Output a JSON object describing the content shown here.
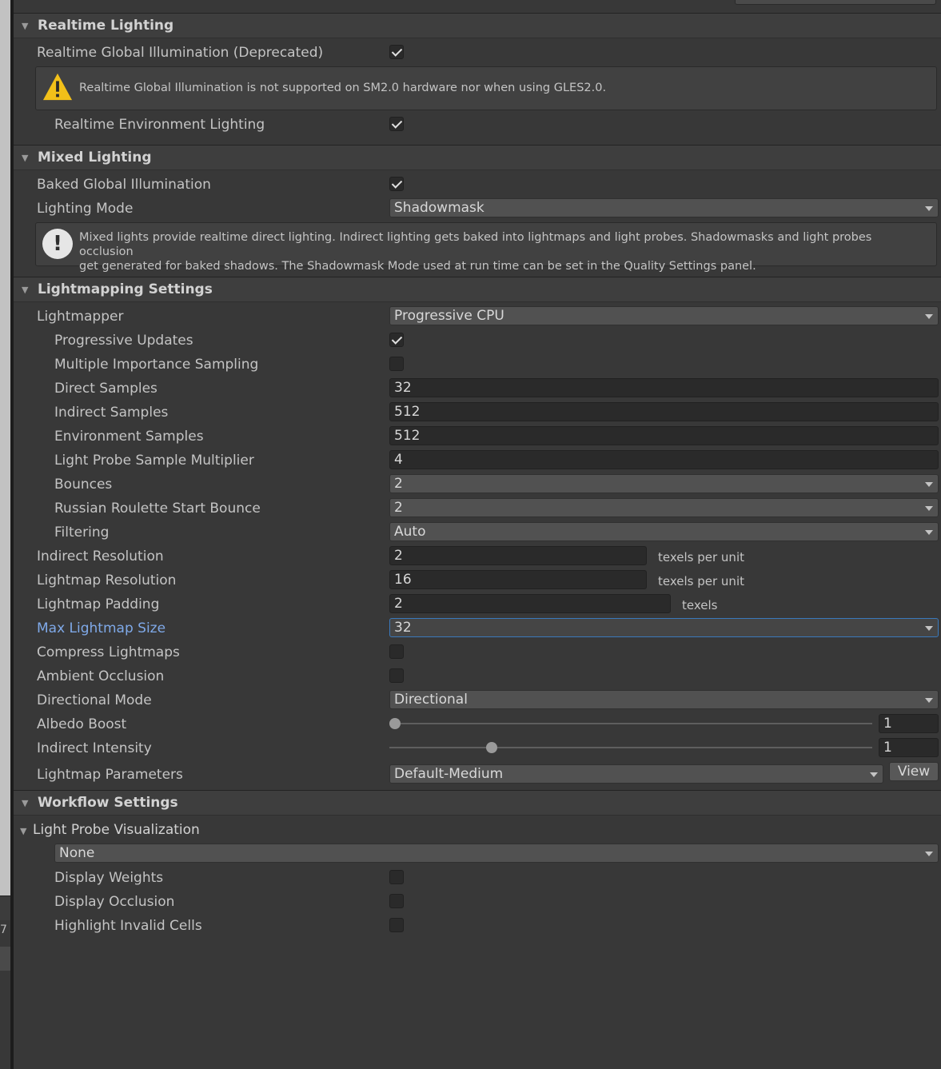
{
  "sections": {
    "realtime_lighting": "Realtime Lighting",
    "mixed_lighting": "Mixed Lighting",
    "lightmapping_settings": "Lightmapping Settings",
    "workflow_settings": "Workflow Settings"
  },
  "realtime": {
    "gi_label": "Realtime Global Illumination (Deprecated)",
    "gi_checked": true,
    "warning": "Realtime Global Illumination is not supported on SM2.0 hardware nor when using GLES2.0.",
    "env_label": "Realtime Environment Lighting",
    "env_checked": true
  },
  "mixed": {
    "baked_gi_label": "Baked Global Illumination",
    "baked_gi_checked": true,
    "mode_label": "Lighting Mode",
    "mode_value": "Shadowmask",
    "info_line1": "Mixed lights provide realtime direct lighting. Indirect lighting gets baked into lightmaps and light probes. Shadowmasks and light probes occlusion",
    "info_line2": "get generated for baked shadows. The Shadowmask Mode used at run time can be set in the Quality Settings panel."
  },
  "lightmapping": {
    "lightmapper_label": "Lightmapper",
    "lightmapper_value": "Progressive CPU",
    "progressive_updates_label": "Progressive Updates",
    "progressive_updates_checked": true,
    "mis_label": "Multiple Importance Sampling",
    "mis_checked": false,
    "direct_samples_label": "Direct Samples",
    "direct_samples_value": "32",
    "indirect_samples_label": "Indirect Samples",
    "indirect_samples_value": "512",
    "env_samples_label": "Environment Samples",
    "env_samples_value": "512",
    "probe_mult_label": "Light Probe Sample Multiplier",
    "probe_mult_value": "4",
    "bounces_label": "Bounces",
    "bounces_value": "2",
    "rr_label": "Russian Roulette Start Bounce",
    "rr_value": "2",
    "filtering_label": "Filtering",
    "filtering_value": "Auto",
    "indirect_res_label": "Indirect Resolution",
    "indirect_res_value": "2",
    "indirect_res_unit": "texels per unit",
    "lightmap_res_label": "Lightmap Resolution",
    "lightmap_res_value": "16",
    "lightmap_res_unit": "texels per unit",
    "padding_label": "Lightmap Padding",
    "padding_value": "2",
    "padding_unit": "texels",
    "max_size_label": "Max Lightmap Size",
    "max_size_value": "32",
    "compress_label": "Compress Lightmaps",
    "compress_checked": false,
    "ao_label": "Ambient Occlusion",
    "ao_checked": false,
    "directional_label": "Directional Mode",
    "directional_value": "Directional",
    "albedo_label": "Albedo Boost",
    "albedo_value": "1",
    "albedo_fraction": 0.0,
    "indirect_int_label": "Indirect Intensity",
    "indirect_int_value": "1",
    "indirect_int_fraction": 0.2,
    "params_label": "Lightmap Parameters",
    "params_value": "Default-Medium",
    "view_label": "View"
  },
  "workflow": {
    "probe_vis_label": "Light Probe Visualization",
    "probe_vis_value": "None",
    "display_weights_label": "Display Weights",
    "display_weights_checked": false,
    "display_occlusion_label": "Display Occlusion",
    "display_occlusion_checked": false,
    "highlight_invalid_label": "Highlight Invalid Cells",
    "highlight_invalid_checked": false
  },
  "side": {
    "fragment_text": "7"
  },
  "colors": {
    "background": "#383838",
    "accent_focus": "#3a79bb",
    "highlight_label": "#7fa9e8",
    "warning": "#f2c019"
  }
}
